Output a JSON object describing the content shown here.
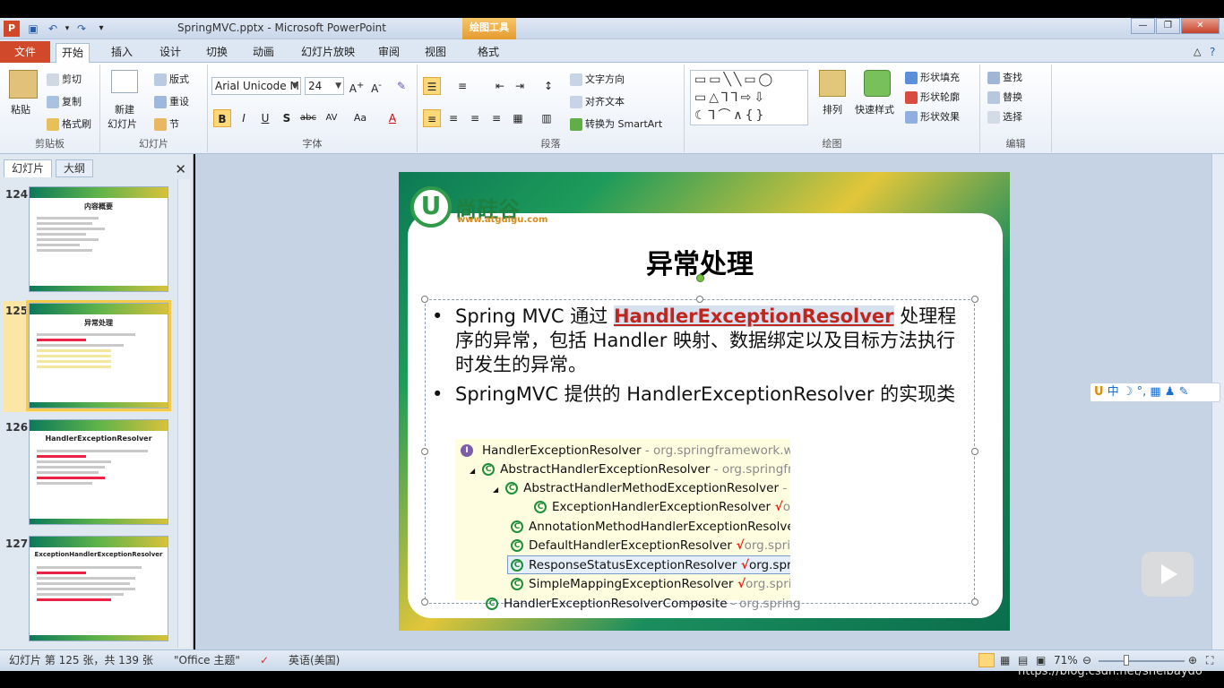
{
  "window": {
    "app_letter": "P",
    "title": "SpringMVC.pptx - Microsoft PowerPoint",
    "contextual_tab": "绘图工具",
    "contextual_sub_tab": "格式"
  },
  "tabs": [
    "开始",
    "插入",
    "设计",
    "切换",
    "动画",
    "幻灯片放映",
    "审阅",
    "视图"
  ],
  "file_tab": "文件",
  "ribbon": {
    "clipboard": {
      "label": "剪贴板",
      "paste": "粘贴",
      "cut": "剪切",
      "copy": "复制",
      "format_painter": "格式刷"
    },
    "slides": {
      "label": "幻灯片",
      "new_slide": "新建",
      "new_slide2": "幻灯片",
      "layout": "版式",
      "reset": "重设",
      "section": "节"
    },
    "font": {
      "label": "字体",
      "font_name": "Arial Unicode M",
      "font_size": "24"
    },
    "paragraph": {
      "label": "段落",
      "text_direction": "文字方向",
      "align_text": "对齐文本",
      "convert_smartart": "转换为 SmartArt"
    },
    "drawing": {
      "label": "绘图",
      "arrange": "排列",
      "quick_styles": "快速样式",
      "shape_fill": "形状填充",
      "shape_outline": "形状轮廓",
      "shape_effects": "形状效果"
    },
    "editing": {
      "label": "编辑",
      "find": "查找",
      "replace": "替换",
      "select": "选择"
    }
  },
  "left_pane": {
    "tabs": [
      "幻灯片",
      "大纲"
    ],
    "thumbnails": [
      {
        "number": "124",
        "title": "内容概要"
      },
      {
        "number": "125",
        "title": "异常处理"
      },
      {
        "number": "126",
        "title": "HandlerExceptionResolver"
      },
      {
        "number": "127",
        "title": "ExceptionHandlerExceptionResolver"
      }
    ]
  },
  "slide": {
    "logo_letter": "U",
    "logo_text": "尚硅谷",
    "logo_url": "www.atguigu.com",
    "title": "异常处理",
    "bullet_marker": "•",
    "bullet1_pre": "Spring MVC 通过 ",
    "bullet1_highlight": "HandlerExceptionResolver",
    "bullet1_post": " 处理程序的异常，包括 Handler 映射、数据绑定以及目标方法执行时发生的异常。",
    "bullet2": "SpringMVC 提供的 HandlerExceptionResolver 的实现类",
    "tree": [
      {
        "name": "HandlerExceptionResolver",
        "pkg": " - org.springframework.web",
        "icon": "I"
      },
      {
        "prefix": "◢",
        "name": "AbstractHandlerExceptionResolver",
        "pkg": " - org.springfra",
        "icon": "C",
        "sup": "A"
      },
      {
        "prefix": "◢",
        "name": "AbstractHandlerMethodExceptionResolver",
        "pkg": " - c",
        "icon": "C",
        "sup": "A"
      },
      {
        "name": "ExceptionHandlerExceptionResolver",
        "chk": " √",
        "pkg": "org",
        "icon": "C"
      },
      {
        "name": "AnnotationMethodHandlerExceptionResolver",
        "pkg": "",
        "icon": "C"
      },
      {
        "name": "DefaultHandlerExceptionResolver",
        "chk": " √",
        "pkg": "org.spring",
        "icon": "C"
      },
      {
        "name": "ResponseStatusExceptionResolver",
        "chk": " √",
        "pkg": "org.sprin",
        "icon": "C"
      },
      {
        "name": "SimpleMappingExceptionResolver",
        "chk": " √",
        "pkg": "org.sprin",
        "icon": "C"
      },
      {
        "name": "HandlerExceptionResolverComposite",
        "pkg": " - org.spring",
        "icon": "C"
      }
    ]
  },
  "ime_bar": "中 ☽ °, ▦ ♟ ✎",
  "status": {
    "slide_info": "幻灯片 第 125 张，共 139 张",
    "theme": "\"Office 主题\"",
    "language": "英语(美国)",
    "zoom": "71%"
  },
  "watermark": "https://blog.csdn.net/shelbaydo"
}
